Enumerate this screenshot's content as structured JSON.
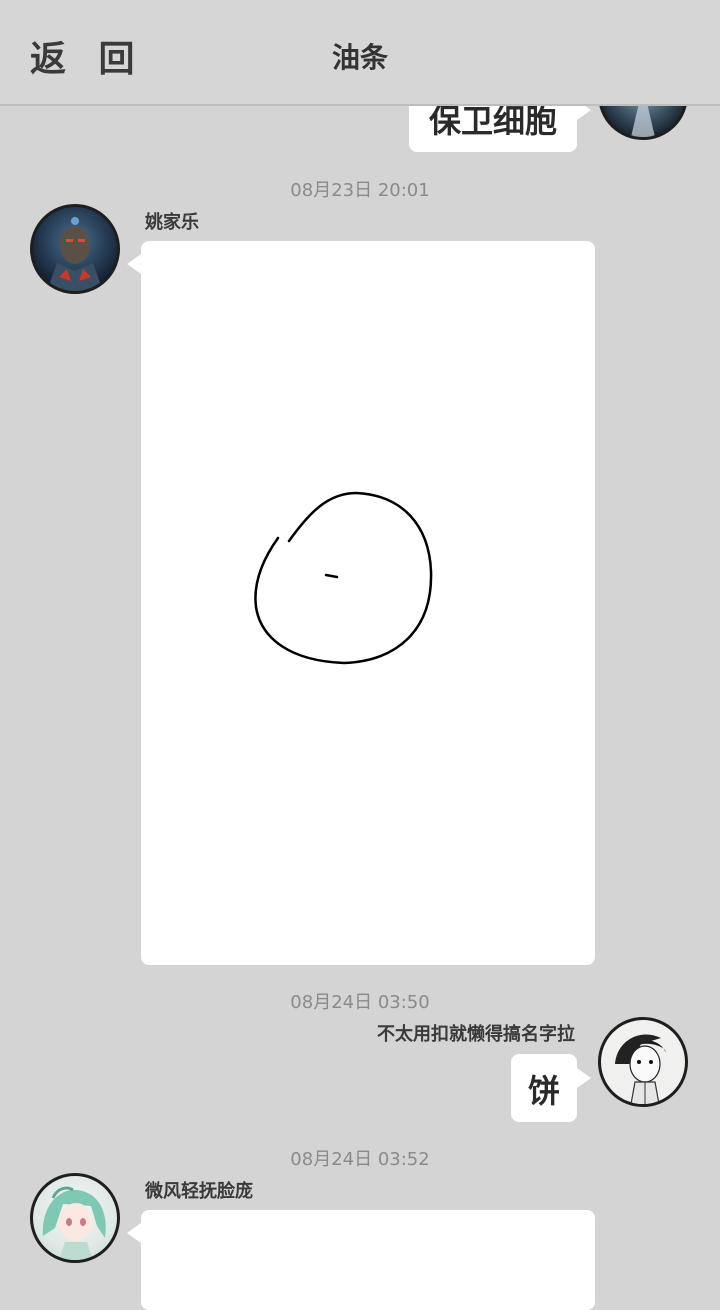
{
  "header": {
    "back_label": "返 回",
    "title": "油条"
  },
  "messages": [
    {
      "direction": "outgoing",
      "type": "text",
      "text": "保卫细胞"
    },
    {
      "timestamp": "08月23日  20:01",
      "sender": "姚家乐",
      "direction": "incoming",
      "type": "drawing"
    },
    {
      "timestamp": "08月24日  03:50",
      "sender": "不太用扣就懒得搞名字拉",
      "direction": "outgoing",
      "type": "text",
      "text": "饼"
    },
    {
      "timestamp": "08月24日  03:52",
      "sender": "微风轻抚脸庞",
      "direction": "incoming",
      "type": "drawing"
    }
  ]
}
